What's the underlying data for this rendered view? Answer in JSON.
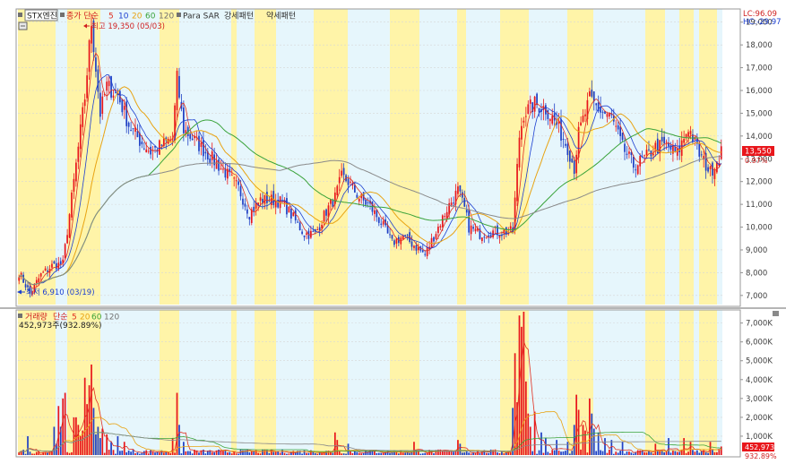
{
  "legend": {
    "stock_name": "STX엔진",
    "price_label": "종가 단순",
    "ma_periods": [
      "5",
      "10",
      "20",
      "60",
      "120"
    ],
    "indicator_label": "Para SAR",
    "strong_pattern": "강세패턴",
    "weak_pattern": "약세패턴",
    "volume_label": "거래량",
    "volume_ma_label": "단순",
    "volume_ma_periods": [
      "5",
      "20",
      "60",
      "120"
    ],
    "volume_value": "452,973주(932.89%)"
  },
  "annotations": {
    "high": "최고 19,350 (05/03)",
    "low": "최저 6,910 (03/19)",
    "lc": "LC:96.09",
    "hc": "HC:-29.97",
    "current_price": "13,550",
    "current_change": "0.97%",
    "current_volume": "452,973",
    "current_volume_pct": "932.89%"
  },
  "colors": {
    "band_yellow": "#fff4a8",
    "band_blue": "#e6f6fc",
    "up": "#e8161b",
    "down": "#1f3fc4",
    "ma5": "#e03020",
    "ma10": "#1c3fd0",
    "ma20": "#e8a312",
    "ma60": "#3aa33a",
    "ma120": "#8a8a8a",
    "axis_text": "#404040",
    "label_red": "#d02020"
  },
  "chart_data": [
    {
      "type": "candlestick",
      "title": "STX엔진",
      "y_axis_ticks": [
        "7,000",
        "8,000",
        "9,000",
        "10,000",
        "11,000",
        "12,000",
        "13,000",
        "14,000",
        "15,000",
        "16,000",
        "17,000",
        "18,000",
        "19,000"
      ],
      "ylim": [
        6600,
        19500
      ],
      "grid": true,
      "high": 19350,
      "low": 6910,
      "last": 13550,
      "bands": [
        "yellow",
        "blue",
        "yellow",
        "blue",
        "yellow",
        "blue",
        "yellow",
        "blue",
        "yellow",
        "blue",
        "yellow",
        "blue",
        "yellow",
        "blue",
        "yellow",
        "blue",
        "yellow",
        "blue",
        "yellow",
        "blue",
        "yellow",
        "blue",
        "yellow",
        "blue",
        "yellow",
        "blue"
      ],
      "price_path_points": [
        [
          0,
          8000
        ],
        [
          5,
          7100
        ],
        [
          10,
          7900
        ],
        [
          15,
          8300
        ],
        [
          20,
          8400
        ],
        [
          25,
          12000
        ],
        [
          30,
          15700
        ],
        [
          33,
          19000
        ],
        [
          37,
          15000
        ],
        [
          40,
          16200
        ],
        [
          45,
          15800
        ],
        [
          50,
          14500
        ],
        [
          55,
          13800
        ],
        [
          60,
          13300
        ],
        [
          65,
          13600
        ],
        [
          70,
          13900
        ],
        [
          72,
          16500
        ],
        [
          75,
          14300
        ],
        [
          80,
          13800
        ],
        [
          85,
          13300
        ],
        [
          90,
          12800
        ],
        [
          95,
          12300
        ],
        [
          100,
          11700
        ],
        [
          105,
          10600
        ],
        [
          110,
          11200
        ],
        [
          115,
          11200
        ],
        [
          120,
          11100
        ],
        [
          125,
          10400
        ],
        [
          130,
          9700
        ],
        [
          135,
          9700
        ],
        [
          140,
          10700
        ],
        [
          144,
          11300
        ],
        [
          147,
          12200
        ],
        [
          150,
          12000
        ],
        [
          155,
          11300
        ],
        [
          160,
          10900
        ],
        [
          165,
          10200
        ],
        [
          170,
          9300
        ],
        [
          175,
          9600
        ],
        [
          180,
          9200
        ],
        [
          185,
          8800
        ],
        [
          190,
          9800
        ],
        [
          195,
          10800
        ],
        [
          200,
          11600
        ],
        [
          203,
          10800
        ],
        [
          205,
          10000
        ],
        [
          210,
          9700
        ],
        [
          215,
          9800
        ],
        [
          220,
          9800
        ],
        [
          225,
          9800
        ],
        [
          228,
          14000
        ],
        [
          230,
          15000
        ],
        [
          235,
          15400
        ],
        [
          240,
          15200
        ],
        [
          245,
          14500
        ],
        [
          250,
          13500
        ],
        [
          253,
          12600
        ],
        [
          255,
          14100
        ],
        [
          260,
          15600
        ],
        [
          265,
          15100
        ],
        [
          270,
          14800
        ],
        [
          275,
          13500
        ],
        [
          280,
          12700
        ],
        [
          285,
          13000
        ],
        [
          290,
          13500
        ],
        [
          295,
          13600
        ],
        [
          300,
          13200
        ],
        [
          305,
          14400
        ],
        [
          310,
          13200
        ],
        [
          315,
          12400
        ],
        [
          320,
          13300
        ]
      ],
      "series": [
        {
          "name": "5",
          "period": 5
        },
        {
          "name": "10",
          "period": 10
        },
        {
          "name": "20",
          "period": 20
        },
        {
          "name": "60",
          "period": 60
        },
        {
          "name": "120",
          "period": 120
        }
      ]
    },
    {
      "type": "bar",
      "title": "거래량",
      "y_axis_ticks": [
        "1,000K",
        "2,000K",
        "3,000K",
        "4,000K",
        "5,000K",
        "6,000K",
        "7,000K"
      ],
      "ylim": [
        0,
        7600000
      ],
      "last_value": 452973,
      "spike_days": [
        [
          4,
          1000000
        ],
        [
          16,
          1500000
        ],
        [
          17,
          600000
        ],
        [
          18,
          2600000
        ],
        [
          19,
          1500000
        ],
        [
          20,
          3000000
        ],
        [
          21,
          3300000
        ],
        [
          25,
          2000000
        ],
        [
          26,
          2000000
        ],
        [
          27,
          1600000
        ],
        [
          28,
          1000000
        ],
        [
          29,
          1300000
        ],
        [
          30,
          4100000
        ],
        [
          31,
          2700000
        ],
        [
          32,
          3700000
        ],
        [
          33,
          4800000
        ],
        [
          34,
          2500000
        ],
        [
          35,
          1100000
        ],
        [
          36,
          1500000
        ],
        [
          37,
          900000
        ],
        [
          38,
          1400000
        ],
        [
          40,
          1100000
        ],
        [
          42,
          700000
        ],
        [
          45,
          1000000
        ],
        [
          48,
          700000
        ],
        [
          70,
          900000
        ],
        [
          72,
          3300000
        ],
        [
          73,
          1600000
        ],
        [
          75,
          700000
        ],
        [
          144,
          1200000
        ],
        [
          145,
          800000
        ],
        [
          150,
          600000
        ],
        [
          180,
          700000
        ],
        [
          200,
          800000
        ],
        [
          201,
          600000
        ],
        [
          225,
          2500000
        ],
        [
          226,
          5400000
        ],
        [
          227,
          2800000
        ],
        [
          228,
          7400000
        ],
        [
          229,
          6800000
        ],
        [
          230,
          7700000
        ],
        [
          231,
          3900000
        ],
        [
          232,
          2200000
        ],
        [
          233,
          1500000
        ],
        [
          235,
          2300000
        ],
        [
          238,
          1200000
        ],
        [
          240,
          900000
        ],
        [
          245,
          800000
        ],
        [
          250,
          700000
        ],
        [
          253,
          1600000
        ],
        [
          254,
          3200000
        ],
        [
          255,
          2400000
        ],
        [
          257,
          1600000
        ],
        [
          258,
          1300000
        ],
        [
          260,
          3000000
        ],
        [
          261,
          2200000
        ],
        [
          262,
          1400000
        ],
        [
          264,
          1200000
        ],
        [
          267,
          900000
        ],
        [
          270,
          800000
        ],
        [
          275,
          700000
        ],
        [
          290,
          600000
        ],
        [
          296,
          900000
        ],
        [
          303,
          900000
        ],
        [
          306,
          700000
        ],
        [
          315,
          700000
        ],
        [
          320,
          900000
        ]
      ]
    }
  ]
}
